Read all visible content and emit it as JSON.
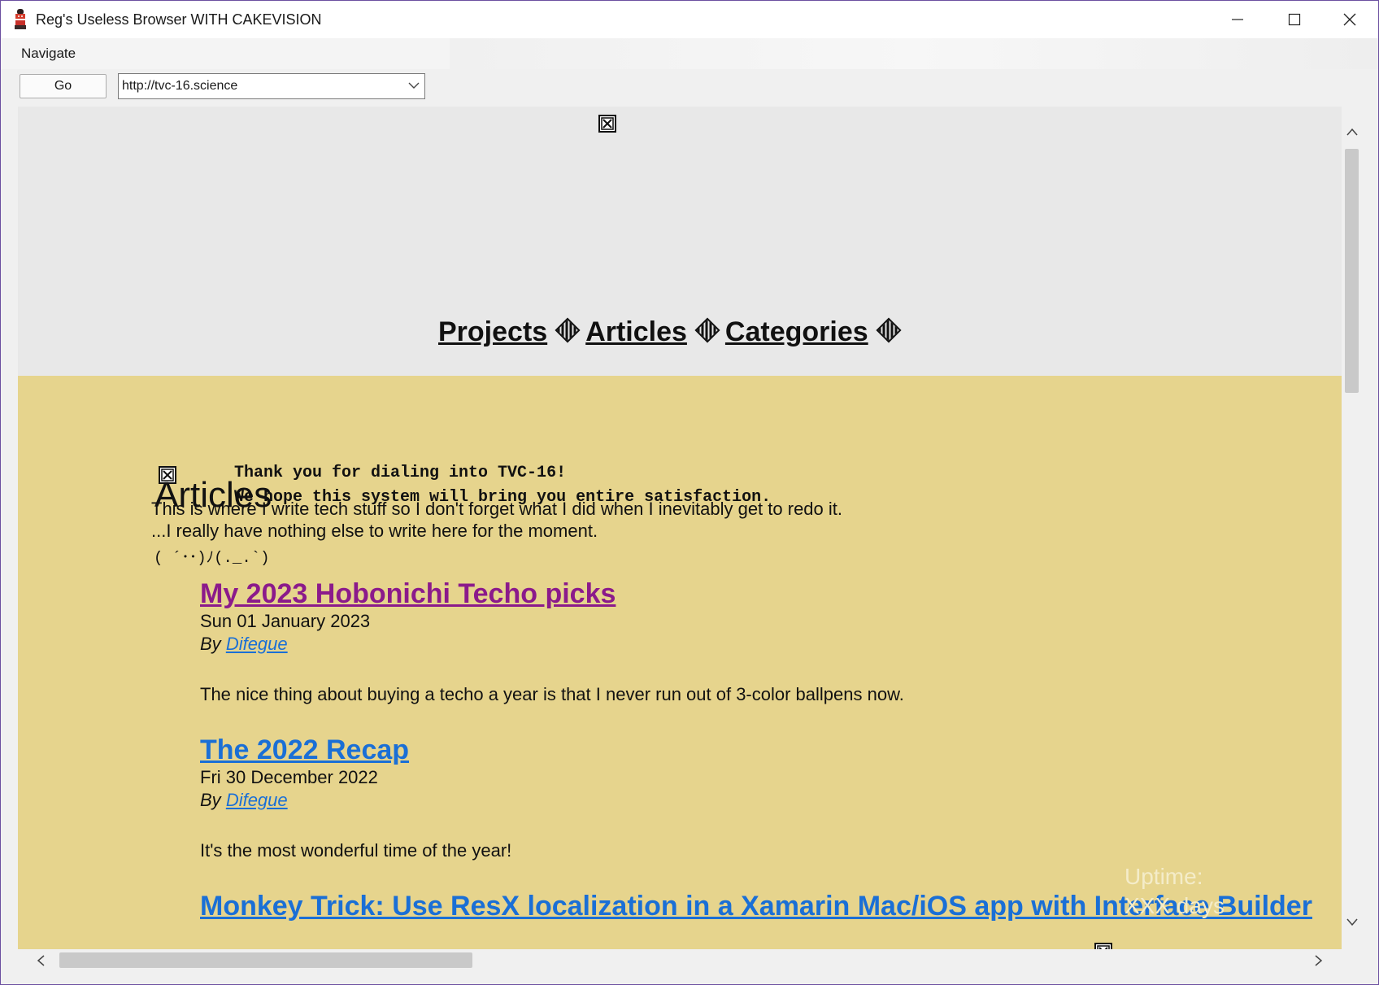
{
  "window": {
    "title": "Reg's Useless Browser WITH CAKEVISION",
    "icon": "cake-app-icon"
  },
  "menu": {
    "navigate": "Navigate"
  },
  "toolbar": {
    "go_label": "Go",
    "url": "http://tvc-16.science"
  },
  "page": {
    "nav": {
      "projects": "Projects",
      "articles": "Articles",
      "categories": "Categories"
    },
    "terminal": {
      "line1": "Thank you for dialing into TVC-16!",
      "line2": "We hope this system will bring you entire satisfaction."
    },
    "heading": "Articles",
    "intro": {
      "line1": "This is where I write tech stuff so I don't forget what I did when I inevitably get to redo it.",
      "line2": "...I really have nothing else to write here for the moment."
    },
    "kaomoji": "( ´･･)ﾉ(._.`)",
    "articles": [
      {
        "title": "My 2023 Hobonichi Techo picks",
        "date": "Sun 01 January 2023",
        "by": "By",
        "author": "Difegue",
        "summary": "The nice thing about buying a techo a year is that I never run out of 3-color ballpens now.",
        "color": "#8b1a8b"
      },
      {
        "title": "The 2022 Recap",
        "date": "Fri 30 December 2022",
        "by": "By",
        "author": "Difegue",
        "summary": "It's the most wonderful time of the year!",
        "color": "#1a6fd6"
      },
      {
        "title": "Monkey Trick: Use ResX localization in a Xamarin Mac/iOS app with Interface Builder",
        "color": "#1a6fd6"
      }
    ],
    "uptime": {
      "line1": "Uptime:",
      "line2": "XXX days"
    }
  },
  "colors": {
    "content_bg": "#e6d48d",
    "header_bg": "#e8e8e8",
    "visited_link": "#8b1a8b",
    "link": "#1a6fd6"
  }
}
